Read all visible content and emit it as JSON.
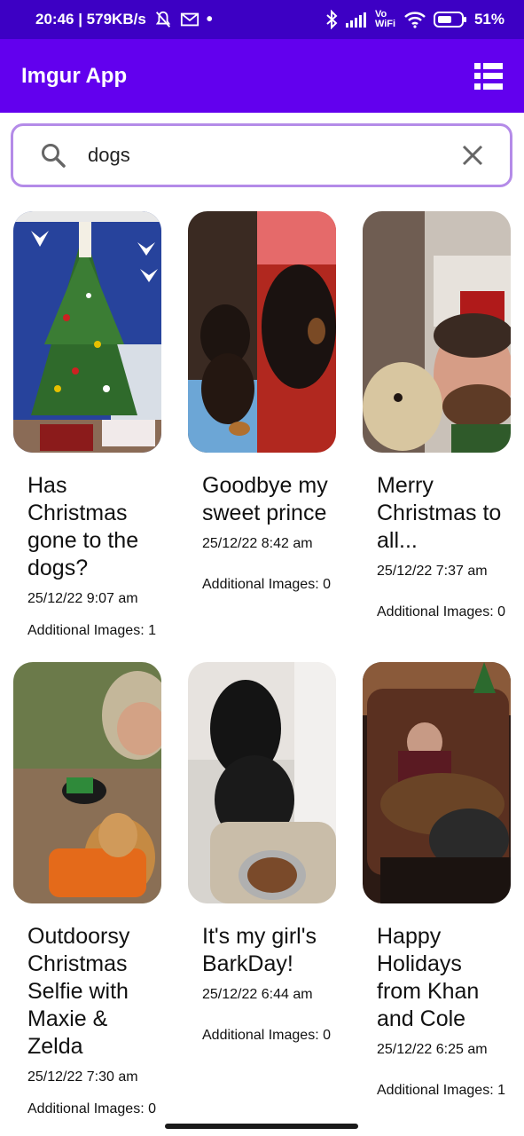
{
  "status_bar": {
    "time_speed": "20:46 | 579KB/s",
    "dot": "•",
    "wifi_label": "Vo WiFi",
    "battery": "51%"
  },
  "app_bar": {
    "title": "Imgur App",
    "list_view_icon": "list-view-icon"
  },
  "search": {
    "value": "dogs",
    "search_icon": "search-icon",
    "clear_icon": "close-icon"
  },
  "posts": [
    {
      "title": "Has Christmas gone to the dogs?",
      "date": "25/12/22 9:07 am",
      "additional": "Additional Images: 1"
    },
    {
      "title": "Goodbye my sweet prince",
      "date": "25/12/22 8:42 am",
      "additional": "Additional Images: 0"
    },
    {
      "title": "Merry Christmas to all...",
      "date": "25/12/22 7:37 am",
      "additional": "Additional Images: 0"
    },
    {
      "title": "Outdoorsy Christmas Selfie with Maxie & Zelda",
      "date": "25/12/22 7:30 am",
      "additional": "Additional Images: 0"
    },
    {
      "title": "It's my girl's BarkDay!",
      "date": "25/12/22 6:44 am",
      "additional": "Additional Images: 0"
    },
    {
      "title": "Happy Holidays from Khan and Cole",
      "date": "25/12/22 6:25 am",
      "additional": "Additional Images: 1"
    }
  ]
}
